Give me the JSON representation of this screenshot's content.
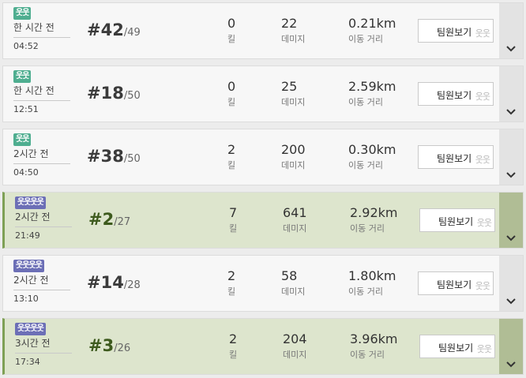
{
  "button_label": "팀원보기",
  "kill_label": "킬",
  "damage_label": "데미지",
  "distance_label": "이동 거리",
  "colors": {
    "win_background": "#dde5cd",
    "normal_background": "#f7f7f7",
    "solo_badge": "#4fae90",
    "squad_badge": "#6c6fb6"
  },
  "matches": [
    {
      "mode_icon": "solo-runner-icon",
      "badge": "웃웃",
      "time_ago": "한 시간 전",
      "duration": "04:52",
      "rank": "#42",
      "total": "/49",
      "kills": "0",
      "damage": "22",
      "distance": "0.21km",
      "win": false
    },
    {
      "mode_icon": "solo-runner-icon",
      "badge": "웃웃",
      "time_ago": "한 시간 전",
      "duration": "12:51",
      "rank": "#18",
      "total": "/50",
      "kills": "0",
      "damage": "25",
      "distance": "2.59km",
      "win": false
    },
    {
      "mode_icon": "solo-runner-icon",
      "badge": "웃웃",
      "time_ago": "2시간 전",
      "duration": "04:50",
      "rank": "#38",
      "total": "/50",
      "kills": "2",
      "damage": "200",
      "distance": "0.30km",
      "win": false
    },
    {
      "mode_icon": "squad-runners-icon",
      "badge": "웃웃웃웃",
      "time_ago": "2시간 전",
      "duration": "21:49",
      "rank": "#2",
      "total": "/27",
      "kills": "7",
      "damage": "641",
      "distance": "2.92km",
      "win": true
    },
    {
      "mode_icon": "squad-runners-icon",
      "badge": "웃웃웃웃",
      "time_ago": "2시간 전",
      "duration": "13:10",
      "rank": "#14",
      "total": "/28",
      "kills": "2",
      "damage": "58",
      "distance": "1.80km",
      "win": false
    },
    {
      "mode_icon": "squad-runners-icon",
      "badge": "웃웃웃웃",
      "time_ago": "3시간 전",
      "duration": "17:34",
      "rank": "#3",
      "total": "/26",
      "kills": "2",
      "damage": "204",
      "distance": "3.96km",
      "win": true
    }
  ]
}
